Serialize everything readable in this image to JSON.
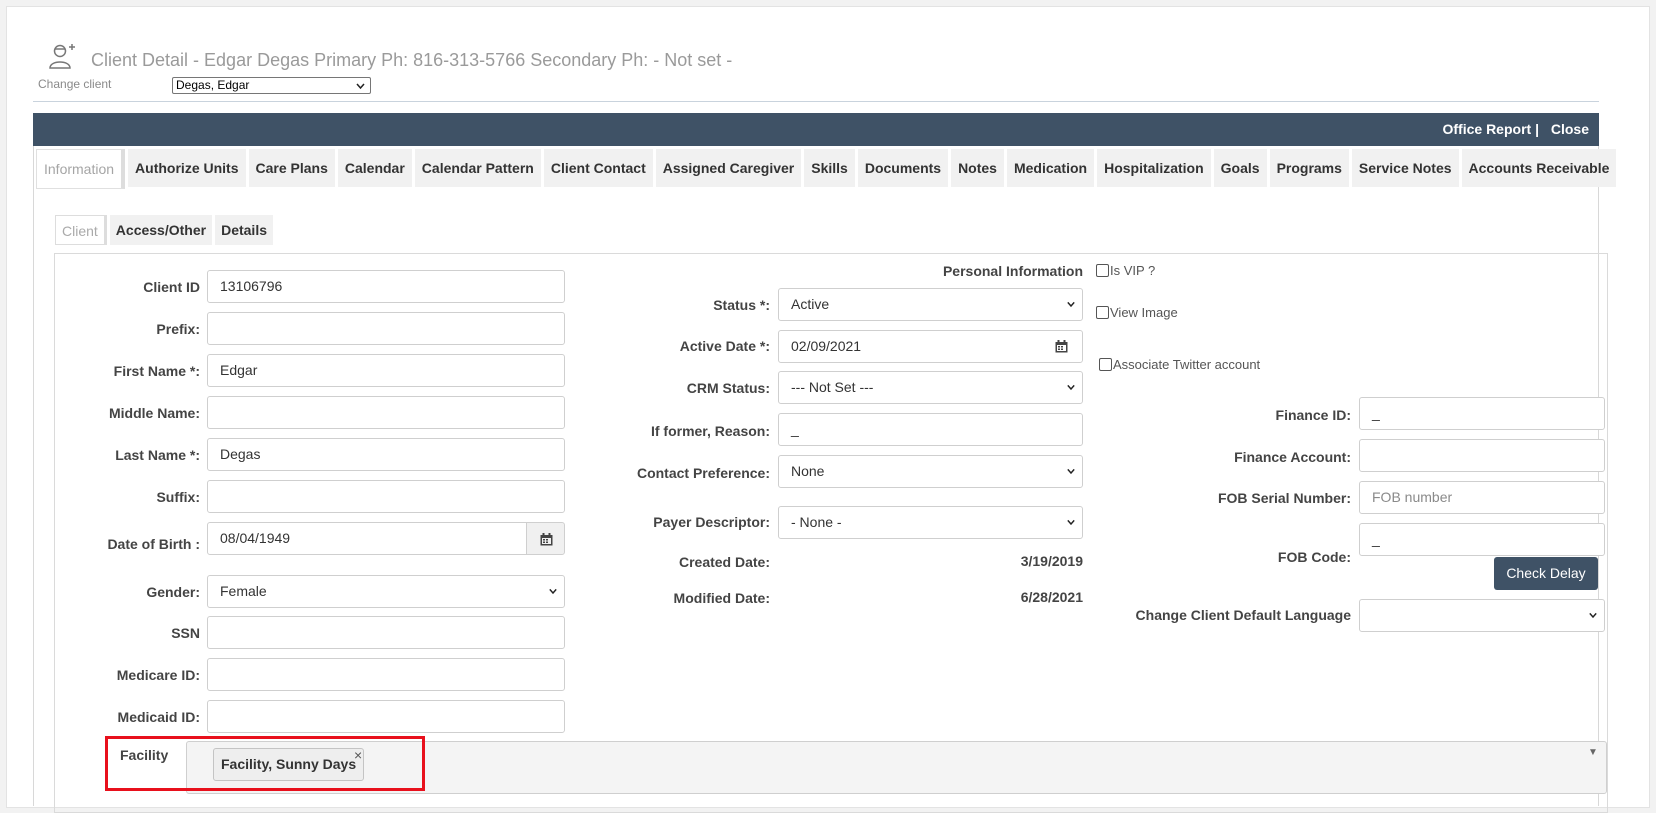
{
  "header": {
    "icon": "client-person-icon",
    "title": "Client Detail - Edgar Degas Primary Ph: 816-313-5766 Secondary Ph: - Not set -",
    "change_client_label": "Change client",
    "change_client_value": "Degas, Edgar"
  },
  "topbar": {
    "office_report": "Office Report |",
    "close": "Close"
  },
  "tabs": [
    {
      "label": "Information",
      "active": true
    },
    {
      "label": "Authorize Units"
    },
    {
      "label": "Care Plans"
    },
    {
      "label": "Calendar"
    },
    {
      "label": "Calendar Pattern"
    },
    {
      "label": "Client Contact"
    },
    {
      "label": "Assigned Caregiver"
    },
    {
      "label": "Skills"
    },
    {
      "label": "Documents"
    },
    {
      "label": "Notes"
    },
    {
      "label": "Medication"
    },
    {
      "label": "Hospitalization"
    },
    {
      "label": "Goals"
    },
    {
      "label": "Programs"
    },
    {
      "label": "Service Notes"
    },
    {
      "label": "Accounts Receivable"
    }
  ],
  "subtabs": [
    {
      "label": "Client",
      "active": true
    },
    {
      "label": "Access/Other"
    },
    {
      "label": "Details"
    }
  ],
  "left": {
    "client_id": {
      "label": "Client ID",
      "value": "13106796"
    },
    "prefix": {
      "label": "Prefix:",
      "value": ""
    },
    "first_name": {
      "label": "First Name *:",
      "value": "Edgar"
    },
    "middle_name": {
      "label": "Middle Name:",
      "value": ""
    },
    "last_name": {
      "label": "Last Name *:",
      "value": "Degas"
    },
    "suffix": {
      "label": "Suffix:",
      "value": ""
    },
    "dob": {
      "label": "Date of Birth :",
      "value": "08/04/1949"
    },
    "gender": {
      "label": "Gender:",
      "value": "Female"
    },
    "ssn": {
      "label": "SSN",
      "value": ""
    },
    "medicare": {
      "label": "Medicare ID:",
      "value": ""
    },
    "medicaid": {
      "label": "Medicaid ID:",
      "value": ""
    }
  },
  "middle": {
    "section_title": "Personal Information",
    "status": {
      "label": "Status *:",
      "value": "Active"
    },
    "active_date": {
      "label": "Active Date *:",
      "value": "02/09/2021"
    },
    "crm_status": {
      "label": "CRM Status:",
      "value": "--- Not Set ---"
    },
    "former_reason": {
      "label": "If former, Reason:",
      "value": "_"
    },
    "contact_pref": {
      "label": "Contact Preference:",
      "value": "None"
    },
    "payer": {
      "label": "Payer Descriptor:",
      "value": "- None -"
    },
    "created": {
      "label": "Created Date:",
      "value": "3/19/2019"
    },
    "modified": {
      "label": "Modified Date:",
      "value": "6/28/2021"
    }
  },
  "right": {
    "is_vip": "Is VIP ?",
    "view_image": "View Image",
    "twitter": "Associate Twitter account",
    "finance_id": {
      "label": "Finance ID:",
      "value": "_"
    },
    "finance_account": {
      "label": "Finance Account:",
      "value": ""
    },
    "fob_serial": {
      "label": "FOB Serial Number:",
      "placeholder": "FOB number"
    },
    "fob_code": {
      "label": "FOB Code:",
      "value": "_"
    },
    "check_delay": "Check Delay",
    "language": {
      "label": "Change Client Default Language",
      "value": ""
    }
  },
  "facility": {
    "label": "Facility",
    "tag": "Facility, Sunny Days",
    "remove": "×"
  },
  "colors": {
    "topbar": "#3f5266",
    "highlight": "#e8101c"
  }
}
